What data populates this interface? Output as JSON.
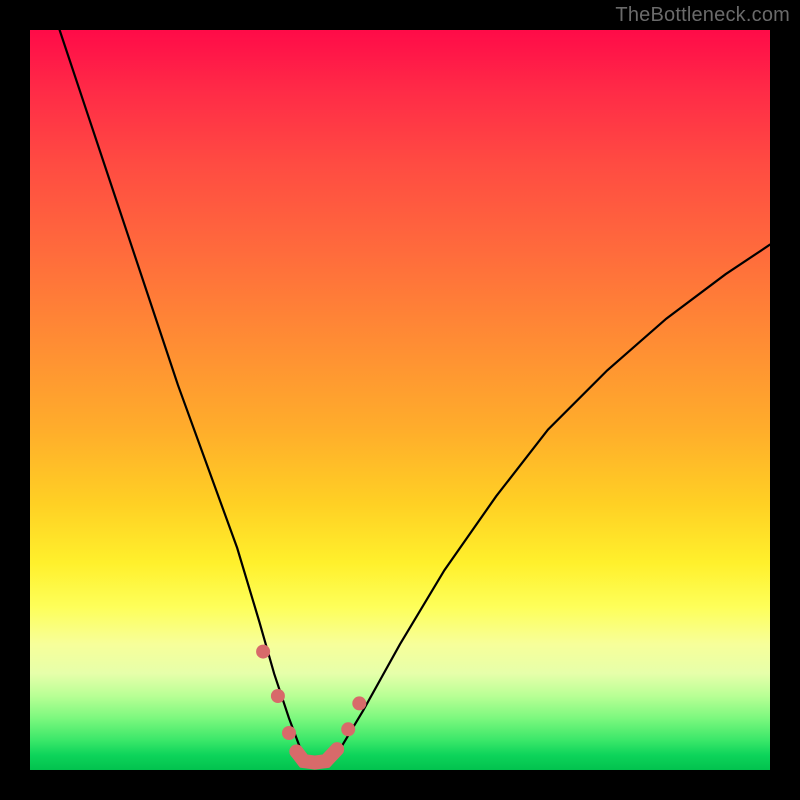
{
  "watermark": "TheBottleneck.com",
  "chart_data": {
    "type": "line",
    "title": "",
    "xlabel": "",
    "ylabel": "",
    "xlim": [
      0,
      100
    ],
    "ylim": [
      0,
      100
    ],
    "background_gradient_meaning": "red=high bottleneck, green=low bottleneck",
    "series": [
      {
        "name": "bottleneck-curve",
        "stroke": "#000000",
        "x": [
          4,
          8,
          12,
          16,
          20,
          24,
          28,
          31,
          33,
          35,
          36.5,
          38,
          40,
          42,
          45,
          50,
          56,
          63,
          70,
          78,
          86,
          94,
          100
        ],
        "values": [
          100,
          88,
          76,
          64,
          52,
          41,
          30,
          20,
          13,
          7,
          3,
          1,
          1,
          3,
          8,
          17,
          27,
          37,
          46,
          54,
          61,
          67,
          71
        ]
      },
      {
        "name": "trough-markers",
        "stroke": "#d86a6a",
        "style": "dots-and-thick-line",
        "x": [
          31.5,
          33.5,
          35.0,
          36.0,
          37.0,
          38.5,
          40.0,
          41.5,
          43.0,
          44.5
        ],
        "values": [
          16.0,
          10.0,
          5.0,
          2.5,
          1.2,
          1.0,
          1.2,
          2.8,
          5.5,
          9.0
        ]
      }
    ],
    "annotations": []
  }
}
